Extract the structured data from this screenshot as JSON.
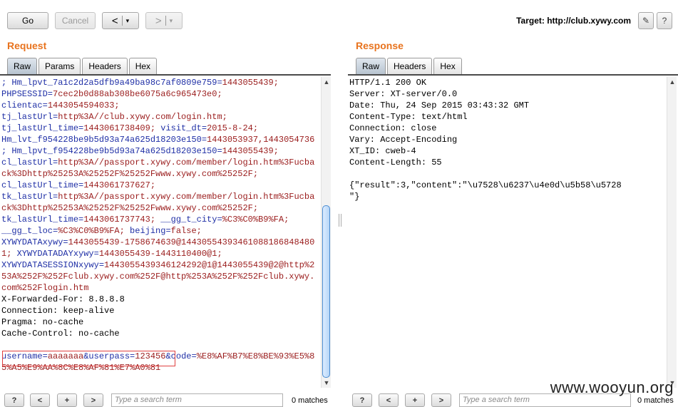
{
  "toolbar": {
    "go_label": "Go",
    "cancel_label": "Cancel",
    "back_arrow": "<",
    "forward_arrow": ">",
    "dropdown_glyph": "▾",
    "target_label": "Target: http://club.xywy.com",
    "edit_icon": "pencil-icon",
    "help_icon": "question-icon",
    "edit_glyph": "✎",
    "help_glyph": "?"
  },
  "request": {
    "title": "Request",
    "tabs": [
      "Raw",
      "Params",
      "Headers",
      "Hex"
    ],
    "active_tab": "Raw",
    "lines": [
      [
        {
          "t": "; Hm_lpvt_7a1c2d2a5dfb9a49ba98c7af0809e759=",
          "c": "k"
        },
        {
          "t": "1443055439;",
          "c": "v"
        }
      ],
      [
        {
          "t": "PHPSESSID=",
          "c": "k"
        },
        {
          "t": "7cec2b0d88ab308be6075a6c965473e0;",
          "c": "v"
        }
      ],
      [
        {
          "t": "clientac=",
          "c": "k"
        },
        {
          "t": "1443054594033;",
          "c": "v"
        }
      ],
      [
        {
          "t": "tj_lastUrl=",
          "c": "k"
        },
        {
          "t": "http%3A//club.xywy.com/login.htm;",
          "c": "v"
        }
      ],
      [
        {
          "t": "tj_lastUrl_time=",
          "c": "k"
        },
        {
          "t": "1443061738409; ",
          "c": "v"
        },
        {
          "t": "visit_dt=",
          "c": "k"
        },
        {
          "t": "2015-8-24;",
          "c": "v"
        }
      ],
      [
        {
          "t": "Hm_lvt_f954228be9b5d93a74a625d18203e150=",
          "c": "k"
        },
        {
          "t": "1443053937,1443054736",
          "c": "v"
        }
      ],
      [
        {
          "t": "; Hm_lpvt_f954228be9b5d93a74a625d18203e150=",
          "c": "k"
        },
        {
          "t": "1443055439;",
          "c": "v"
        }
      ],
      [
        {
          "t": "cl_lastUrl=",
          "c": "k"
        },
        {
          "t": "http%3A//passport.xywy.com/member/login.htm%3Fucba",
          "c": "v"
        }
      ],
      [
        {
          "t": "ck%3Dhttp%25253A%25252F%25252Fwww.xywy.com%25252F;",
          "c": "v"
        }
      ],
      [
        {
          "t": "cl_lastUrl_time=",
          "c": "k"
        },
        {
          "t": "1443061737627;",
          "c": "v"
        }
      ],
      [
        {
          "t": "tk_lastUrl=",
          "c": "k"
        },
        {
          "t": "http%3A//passport.xywy.com/member/login.htm%3Fucba",
          "c": "v"
        }
      ],
      [
        {
          "t": "ck%3Dhttp%25253A%25252F%25252Fwww.xywy.com%25252F;",
          "c": "v"
        }
      ],
      [
        {
          "t": "tk_lastUrl_time=",
          "c": "k"
        },
        {
          "t": "1443061737743; ",
          "c": "v"
        },
        {
          "t": "__gg_t_city=",
          "c": "k"
        },
        {
          "t": "%C3%C0%B9%FA;",
          "c": "v"
        }
      ],
      [
        {
          "t": "__gg_t_loc=",
          "c": "k"
        },
        {
          "t": "%C3%C0%B9%FA; ",
          "c": "v"
        },
        {
          "t": "beijing=",
          "c": "k"
        },
        {
          "t": "false;",
          "c": "v"
        }
      ],
      [
        {
          "t": "XYWYDATAxywy=",
          "c": "k"
        },
        {
          "t": "1443055439-1758674639@14430554393461088186848480",
          "c": "v"
        }
      ],
      [
        {
          "t": "1; ",
          "c": "v"
        },
        {
          "t": "XYWYDATADAYxywy=",
          "c": "k"
        },
        {
          "t": "1443055439-1443110400@1;",
          "c": "v"
        }
      ],
      [
        {
          "t": "XYWYDATASESSIONxywy=",
          "c": "k"
        },
        {
          "t": "1443055439346124292@1@1443055439@2@http%2",
          "c": "v"
        }
      ],
      [
        {
          "t": "53A%252F%252Fclub.xywy.com%252F@http%253A%252F%252Fclub.xywy.",
          "c": "v"
        }
      ],
      [
        {
          "t": "com%252Flogin.htm",
          "c": "v"
        }
      ],
      [
        {
          "t": "X-Forwarded-For: 8.8.8.8",
          "c": ""
        }
      ],
      [
        {
          "t": "Connection: keep-alive",
          "c": ""
        }
      ],
      [
        {
          "t": "Pragma: no-cache",
          "c": ""
        }
      ],
      [
        {
          "t": "Cache-Control: no-cache",
          "c": ""
        }
      ],
      [
        {
          "t": "",
          "c": ""
        }
      ],
      [
        {
          "t": "username=",
          "c": "k"
        },
        {
          "t": "aaaaaaa",
          "c": "v"
        },
        {
          "t": "&userpass=",
          "c": "k"
        },
        {
          "t": "123456",
          "c": "v"
        },
        {
          "t": "&code=",
          "c": "k"
        },
        {
          "t": "%E8%AF%B7%E8%BE%93%E5%8",
          "c": "v"
        }
      ],
      [
        {
          "t": "5%A5%E9%AA%8C%E8%AF%81%E7%A0%81",
          "c": "v"
        }
      ]
    ],
    "search": {
      "placeholder": "Type a search term",
      "matches": "0 matches"
    }
  },
  "response": {
    "title": "Response",
    "tabs": [
      "Raw",
      "Headers",
      "Hex"
    ],
    "active_tab": "Raw",
    "lines": [
      [
        {
          "t": "HTTP/1.1 200 OK",
          "c": ""
        }
      ],
      [
        {
          "t": "Server: XT-server/0.0",
          "c": ""
        }
      ],
      [
        {
          "t": "Date: Thu, 24 Sep 2015 03:43:32 GMT",
          "c": ""
        }
      ],
      [
        {
          "t": "Content-Type: text/html",
          "c": ""
        }
      ],
      [
        {
          "t": "Connection: close",
          "c": ""
        }
      ],
      [
        {
          "t": "Vary: Accept-Encoding",
          "c": ""
        }
      ],
      [
        {
          "t": "XT_ID: cweb-4",
          "c": ""
        }
      ],
      [
        {
          "t": "Content-Length: 55",
          "c": ""
        }
      ],
      [
        {
          "t": "",
          "c": ""
        }
      ],
      [
        {
          "t": "{\"result\":3,\"content\":\"\\u7528\\u6237\\u4e0d\\u5b58\\u5728",
          "c": ""
        }
      ],
      [
        {
          "t": "\"}",
          "c": ""
        }
      ]
    ],
    "search": {
      "placeholder": "Type a search term",
      "matches": "0 matches"
    }
  },
  "search_buttons": [
    "?",
    "<",
    "+",
    ">"
  ],
  "scroll_arrows": {
    "up": "▲",
    "down": "▼"
  },
  "watermark": "www.wooyun.org"
}
